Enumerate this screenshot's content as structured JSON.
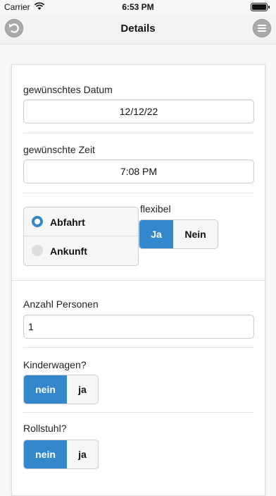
{
  "status": {
    "carrier": "Carrier",
    "time": "6:53 PM"
  },
  "header": {
    "title": "Details"
  },
  "form": {
    "date_label": "gewünschtes Datum",
    "date_value": "12/12/22",
    "time_label": "gewünschte Zeit",
    "time_value": "7:08 PM",
    "mode_options": [
      "Abfahrt",
      "Ankunft"
    ],
    "mode_selected": "Abfahrt",
    "flexible_label": "flexibel",
    "flexible_options": [
      "Ja",
      "Nein"
    ],
    "flexible_selected": "Ja",
    "persons_label": "Anzahl Personen",
    "persons_value": "1",
    "stroller_label": "Kinderwagen?",
    "stroller_options": [
      "nein",
      "ja"
    ],
    "stroller_selected": "nein",
    "wheelchair_label": "Rollstuhl?",
    "wheelchair_options": [
      "nein",
      "ja"
    ],
    "wheelchair_selected": "nein"
  },
  "colors": {
    "accent": "#3388cc",
    "header_bg": "#f2f2f2"
  }
}
